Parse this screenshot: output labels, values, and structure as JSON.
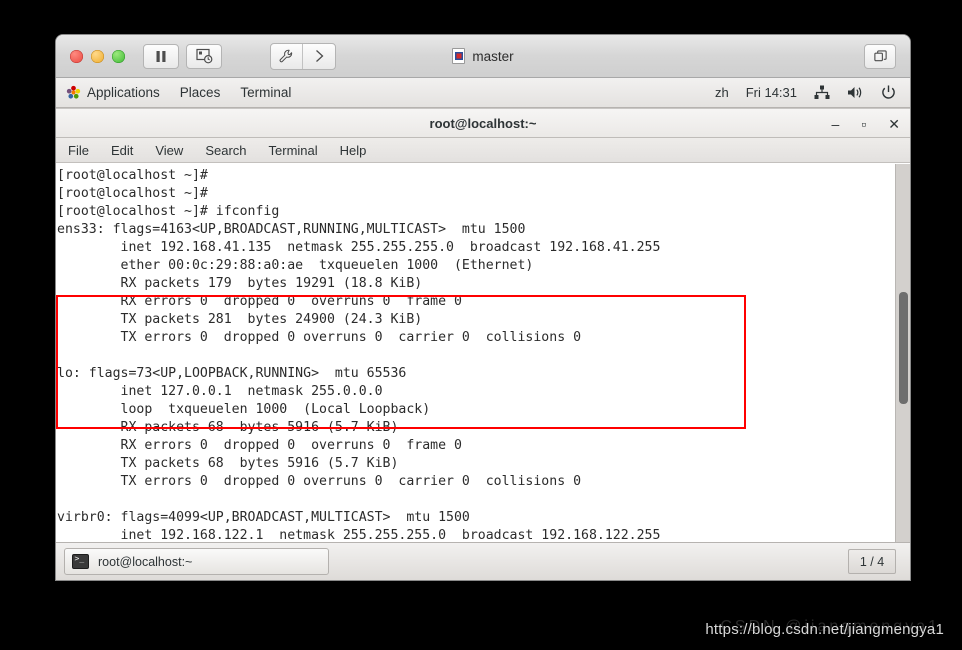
{
  "vm_window": {
    "title": "master",
    "toolbar": {
      "pause_label": "pause",
      "snapshot_label": "snapshot",
      "settings_label": "settings",
      "expand_label": "expand"
    },
    "right_button_label": "unity-view"
  },
  "gnome_panel": {
    "menus": [
      "Applications",
      "Places",
      "Terminal"
    ],
    "language": "zh",
    "clock": "Fri 14:31",
    "indicators": [
      "network-icon",
      "volume-icon",
      "power-icon"
    ]
  },
  "terminal": {
    "title": "root@localhost:~",
    "menus": [
      "File",
      "Edit",
      "View",
      "Search",
      "Terminal",
      "Help"
    ],
    "window_controls": {
      "minimize": "–",
      "maximize": "▫",
      "close": "✕"
    },
    "content": "[root@localhost ~]#\n[root@localhost ~]#\n[root@localhost ~]# ifconfig\nens33: flags=4163<UP,BROADCAST,RUNNING,MULTICAST>  mtu 1500\n        inet 192.168.41.135  netmask 255.255.255.0  broadcast 192.168.41.255\n        ether 00:0c:29:88:a0:ae  txqueuelen 1000  (Ethernet)\n        RX packets 179  bytes 19291 (18.8 KiB)\n        RX errors 0  dropped 0  overruns 0  frame 0\n        TX packets 281  bytes 24900 (24.3 KiB)\n        TX errors 0  dropped 0 overruns 0  carrier 0  collisions 0\n\nlo: flags=73<UP,LOOPBACK,RUNNING>  mtu 65536\n        inet 127.0.0.1  netmask 255.0.0.0\n        loop  txqueuelen 1000  (Local Loopback)\n        RX packets 68  bytes 5916 (5.7 KiB)\n        RX errors 0  dropped 0  overruns 0  frame 0\n        TX packets 68  bytes 5916 (5.7 KiB)\n        TX errors 0  dropped 0 overruns 0  carrier 0  collisions 0\n\nvirbr0: flags=4099<UP,BROADCAST,MULTICAST>  mtu 1500\n        inet 192.168.122.1  netmask 255.255.255.0  broadcast 192.168.122.255"
  },
  "taskbar": {
    "window_button": "root@localhost:~",
    "workspace": "1 / 4"
  },
  "annotation": {
    "highlight_color": "#ff0000",
    "highlight_target": "ens33"
  },
  "watermark": {
    "url": "https://blog.csdn.net/jiangmengya1",
    "ghost": "CSDN @jiangmengya1"
  }
}
